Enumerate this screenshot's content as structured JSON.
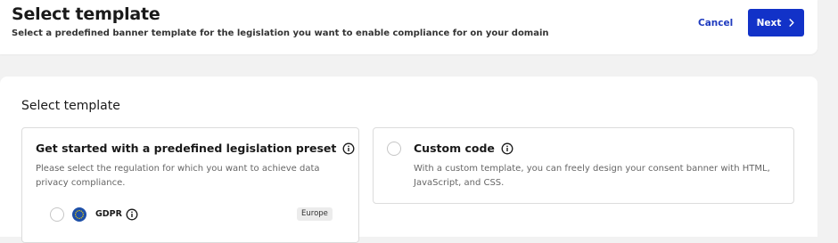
{
  "header": {
    "title": "Select template",
    "subtitle": "Select a predefined banner template for the legislation you want to enable compliance for on your domain",
    "cancel_label": "Cancel",
    "next_label": "Next"
  },
  "main": {
    "section_title": "Select template",
    "preset_option": {
      "title": "Get started with a predefined legislation preset",
      "description": "Please select the regulation for which you want to achieve data privacy compliance.",
      "presets": [
        {
          "label": "GDPR",
          "region": "Europe",
          "icon": "eu-flag-icon"
        }
      ]
    },
    "custom_option": {
      "title": "Custom code",
      "description": "With a custom template, you can freely design your consent banner with HTML, JavaScript, and CSS."
    }
  },
  "colors": {
    "accent": "#1232c8",
    "link": "#1f3bbf",
    "page_bg": "#f2f2f2",
    "eu_flag": "#1d4fa8"
  }
}
